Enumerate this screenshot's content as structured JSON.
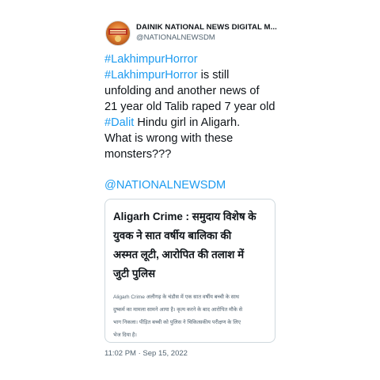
{
  "author": {
    "display_name": "DAINIK NATIONAL NEWS DIGITAL M...",
    "handle": "@NATIONALNEWSDM",
    "avatar_icon": "news-logo-icon"
  },
  "tweet": {
    "hashtag_1": "#LakhimpurHorror",
    "hashtag_2": "#LakhimpurHorror",
    "text_2_rest": " is still",
    "text_3": "unfolding and another news of",
    "text_4": "21 year old Talib raped 7 year old",
    "hashtag_dalit": "#Dalit",
    "text_5_rest": " Hindu girl in Aligarh.",
    "text_6": "What is wrong with these",
    "text_7": "monsters???",
    "mention": "@NATIONALNEWSDM"
  },
  "card": {
    "title_lines": [
      "Aligarh Crime : समुदाय विशेष के",
      "युवक ने सात वर्षीय बालिका की",
      "अस्मत लूटी, आरोपित की तलाश में",
      "जुटी पुलिस"
    ],
    "description_lines": [
      "Aligarh Crime अलीगढ़ के चंडौस में एक सात वर्षीय बच्ची के साथ",
      "दुष्कर्म का मामला सामने आया है। कृत्य करने के बाद आरोपित मौके से",
      "भाग निकला। पीड़ित बच्ची को पुलिस ने चिकित्सकीय परीक्षण के लिए",
      "भेज दिया है।"
    ]
  },
  "timestamp": "11:02 PM · Sep 15, 2022",
  "colors": {
    "link": "#1d9bf0",
    "text": "#0f1419",
    "secondary": "#536471",
    "border": "#cfd9de"
  }
}
